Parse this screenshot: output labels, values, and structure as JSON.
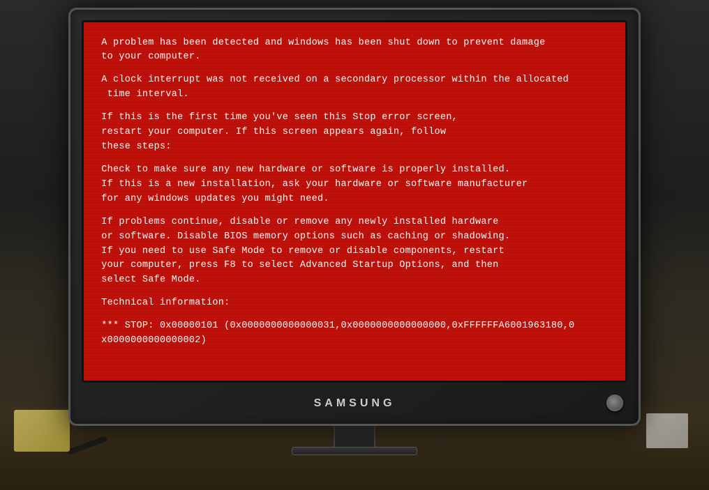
{
  "monitor": {
    "brand": "SAMSUNG",
    "screen": {
      "background_color": "#c0110a",
      "text_color": "#ffffff"
    }
  },
  "bsod": {
    "line1": "A problem has been detected and windows has been shut down to prevent damage\nto your computer.",
    "line2": "A clock interrupt was not received on a secondary processor within the allocated\n time interval.",
    "line3": "If this is the first time you've seen this Stop error screen,\nrestart your computer. If this screen appears again, follow\nthese steps:",
    "line4": "Check to make sure any new hardware or software is properly installed.\nIf this is a new installation, ask your hardware or software manufacturer\nfor any windows updates you might need.",
    "line5": "If problems continue, disable or remove any newly installed hardware\nor software. Disable BIOS memory options such as caching or shadowing.\nIf you need to use Safe Mode to remove or disable components, restart\nyour computer, press F8 to select Advanced Startup Options, and then\nselect Safe Mode.",
    "line6": "Technical information:",
    "line7": "*** STOP: 0x00000101 (0x0000000000000031,0x0000000000000000,0xFFFFFFA6001963180,0\nx0000000000000002)"
  }
}
